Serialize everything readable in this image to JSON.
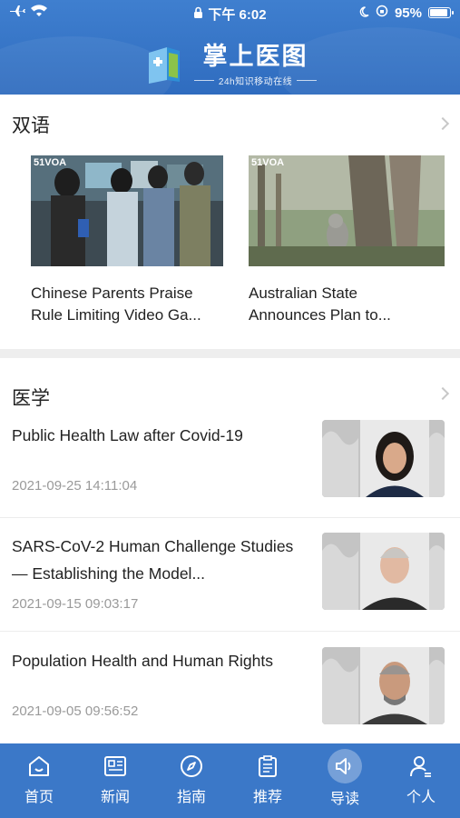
{
  "status_bar": {
    "time": "下午 6:02",
    "battery": "95%"
  },
  "header": {
    "app_title": "掌上医图",
    "subtitle": "24h知识移动在线"
  },
  "bilingual": {
    "heading": "双语",
    "cards": [
      {
        "caption_line1": "Chinese Parents Praise",
        "caption_line2": "Rule Limiting Video Ga...",
        "badge": "51VOA"
      },
      {
        "caption_line1": "Australian State",
        "caption_line2": "Announces Plan to...",
        "badge": "51VOA"
      }
    ]
  },
  "medicine": {
    "heading": "医学",
    "items": [
      {
        "title": "Public Health Law after Covid-19",
        "date": "2021-09-25 14:11:04"
      },
      {
        "title": "SARS-CoV-2 Human Challenge Studies — Establishing the Model...",
        "date": "2021-09-15 09:03:17"
      },
      {
        "title": "Population Health and Human Rights",
        "date": "2021-09-05 09:56:52"
      }
    ]
  },
  "tabbar": {
    "tabs": [
      {
        "label": "首页",
        "icon": "home-icon"
      },
      {
        "label": "新闻",
        "icon": "news-icon"
      },
      {
        "label": "指南",
        "icon": "compass-icon"
      },
      {
        "label": "推荐",
        "icon": "clipboard-icon"
      },
      {
        "label": "导读",
        "icon": "speaker-icon",
        "active": true
      },
      {
        "label": "个人",
        "icon": "profile-icon"
      }
    ]
  },
  "colors": {
    "brand_blue": "#3b78c8",
    "date_gray": "#9a9a9a"
  }
}
